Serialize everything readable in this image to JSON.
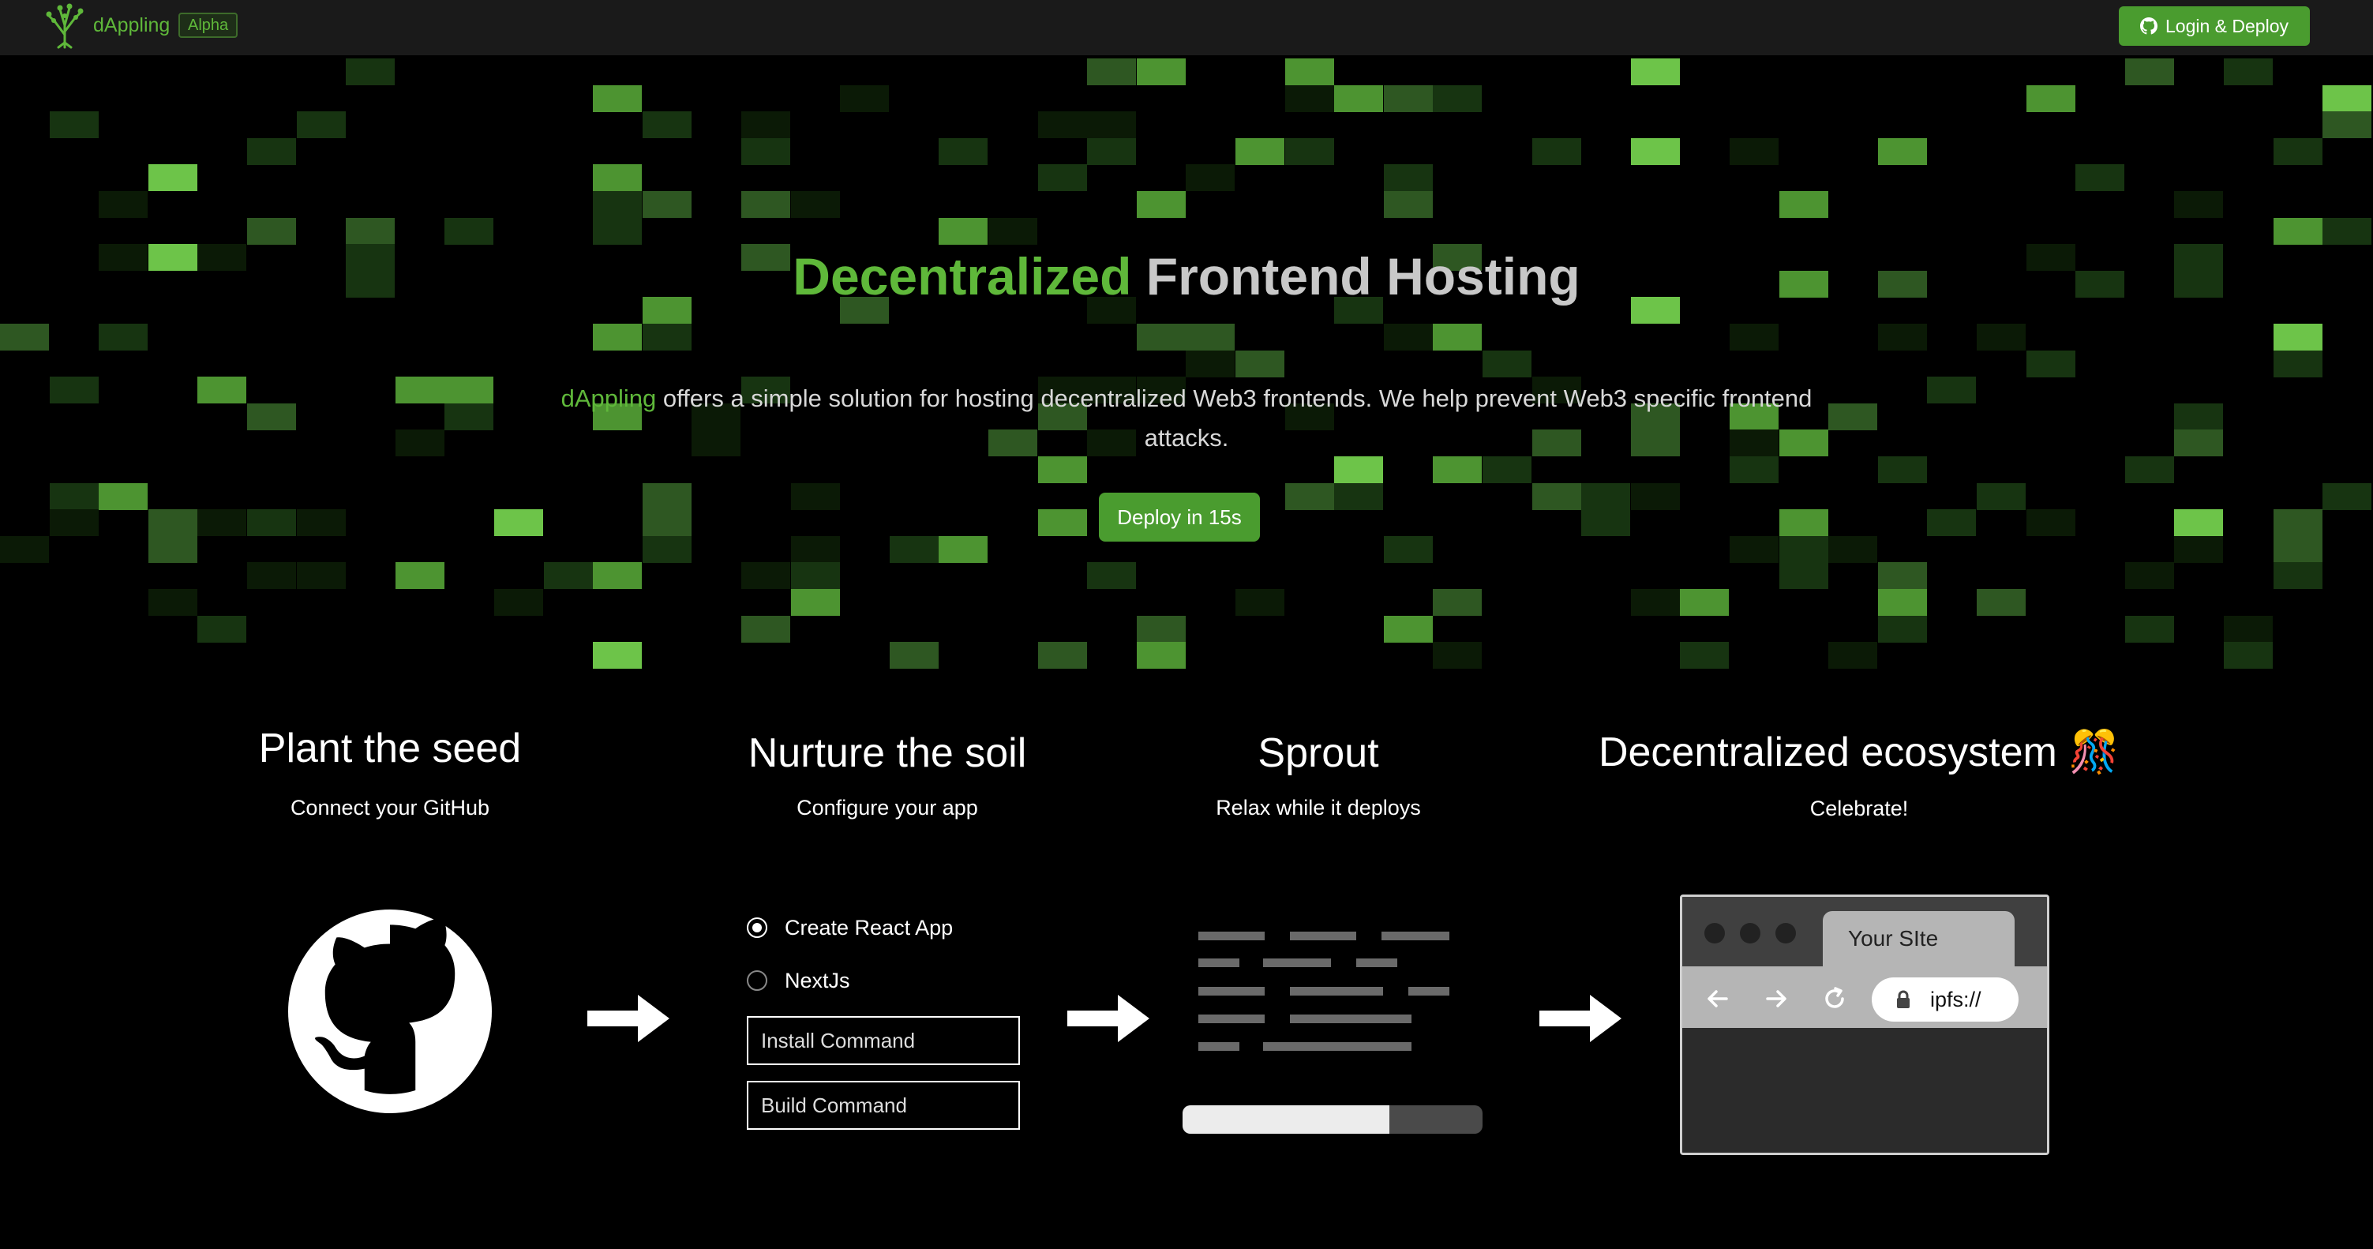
{
  "header": {
    "brand": "dAppling",
    "badge": "Alpha",
    "login_button": "Login & Deploy"
  },
  "hero": {
    "title_accent": "Decentralized",
    "title_rest": "Frontend Hosting",
    "desc_brand": "dAppling",
    "desc_rest": "offers a simple solution for hosting decentralized Web3 frontends. We help prevent Web3 specific frontend attacks.",
    "cta_label": "Deploy in 15s"
  },
  "steps": [
    {
      "title": "Plant the seed",
      "subtitle": "Connect your GitHub"
    },
    {
      "title": "Nurture the soil",
      "subtitle": "Configure your app"
    },
    {
      "title": "Sprout",
      "subtitle": "Relax while it deploys"
    },
    {
      "title": "Decentralized ecosystem 🎊",
      "subtitle": "Celebrate!"
    }
  ],
  "configure": {
    "options": [
      {
        "label": "Create React App",
        "selected": true
      },
      {
        "label": "NextJs",
        "selected": false
      }
    ],
    "install_placeholder": "Install Command",
    "build_placeholder": "Build Command"
  },
  "deploy_progress": 0.69,
  "browser": {
    "tab_title": "Your SIte",
    "url": "ipfs://"
  },
  "colors": {
    "accent": "#5fb83a",
    "button": "#4a9c2f",
    "background": "#000000",
    "topbar": "#1a1a1a"
  },
  "icons": [
    "tree-logo-icon",
    "github-icon",
    "arrow-right-icon",
    "back-icon",
    "forward-icon",
    "reload-icon",
    "lock-icon",
    "confetti-icon"
  ]
}
